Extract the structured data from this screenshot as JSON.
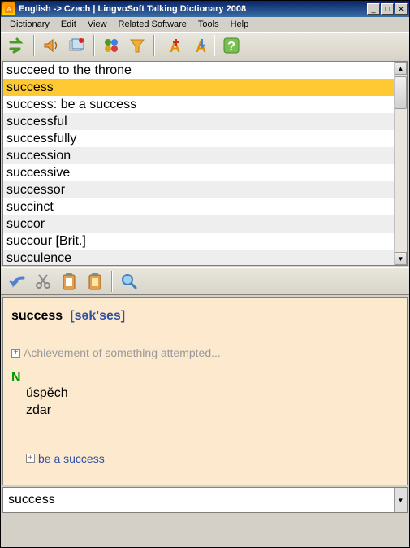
{
  "titlebar": {
    "text": "English -> Czech | LingvoSoft Talking Dictionary 2008"
  },
  "menubar": {
    "items": [
      "Dictionary",
      "Edit",
      "View",
      "Related Software",
      "Tools",
      "Help"
    ]
  },
  "wordlist": {
    "items": [
      "succeed to the throne",
      "success",
      "success: be a success",
      "successful",
      "successfully",
      "succession",
      "successive",
      "successor",
      "succinct",
      "succor",
      "succour [Brit.]",
      "succulence"
    ],
    "selected_index": 1
  },
  "definition": {
    "headword": "success",
    "phonetic": "[sək'ses]",
    "description": "Achievement of something attempted...",
    "pos": "N",
    "translations": [
      "úspěch",
      "zdar"
    ],
    "related": "be a success"
  },
  "search": {
    "value": "success"
  }
}
